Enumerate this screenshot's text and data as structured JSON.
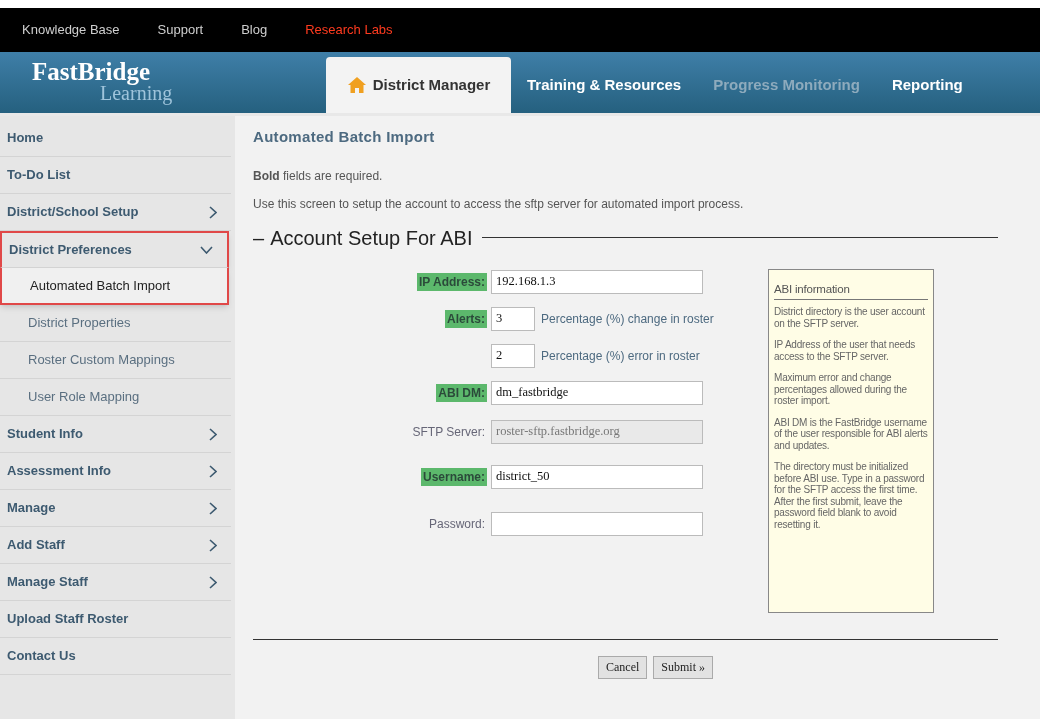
{
  "top_links": [
    {
      "label": "Knowledge Base",
      "highlighted": false
    },
    {
      "label": "Support",
      "highlighted": false
    },
    {
      "label": "Blog",
      "highlighted": false
    },
    {
      "label": "Research Labs",
      "highlighted": true
    }
  ],
  "logo": {
    "name": "FastBridge",
    "subtitle": "Learning"
  },
  "tabs": [
    {
      "label": "District Manager",
      "selected": true,
      "disabled": false
    },
    {
      "label": "Training & Resources",
      "selected": false,
      "disabled": false
    },
    {
      "label": "Progress Monitoring",
      "selected": false,
      "disabled": true
    },
    {
      "label": "Reporting",
      "selected": false,
      "disabled": false
    }
  ],
  "sidebar": {
    "items": [
      {
        "label": "Home",
        "highlighted": false
      },
      {
        "label": "To-Do List",
        "highlighted": false
      },
      {
        "label": "District/School Setup",
        "expanded": false,
        "highlighted": false
      },
      {
        "label": "District Preferences",
        "expanded": true,
        "highlighted": true,
        "children": [
          {
            "label": "Automated Batch Import",
            "selected": true,
            "highlighted": true
          },
          {
            "label": "District Properties",
            "selected": false,
            "highlighted": false
          },
          {
            "label": "Roster Custom Mappings",
            "selected": false,
            "highlighted": false
          },
          {
            "label": "User Role Mapping",
            "selected": false,
            "highlighted": false
          }
        ]
      },
      {
        "label": "Student Info",
        "expanded": false,
        "highlighted": false
      },
      {
        "label": "Assessment Info",
        "expanded": false,
        "highlighted": false
      },
      {
        "label": "Manage",
        "expanded": false,
        "highlighted": false
      },
      {
        "label": "Add Staff",
        "expanded": false,
        "highlighted": false
      },
      {
        "label": "Manage Staff",
        "expanded": false,
        "highlighted": false
      },
      {
        "label": "Upload Staff Roster",
        "highlighted": false
      },
      {
        "label": "Contact Us",
        "highlighted": false
      }
    ]
  },
  "page_title": "Automated Batch Import",
  "required_note": "**Bold** fields are required.",
  "description": "Use this screen to setup the account to access the sftp server for automated import process.",
  "section_title": "Account Setup For ABI",
  "section_marker": "–",
  "form": [
    {
      "kind": "text",
      "label": "IP Address:",
      "required": true,
      "disabled": false,
      "value": "192.168.1.3"
    },
    {
      "kind": "percent",
      "label": "Alerts:",
      "required": true,
      "disabled": false,
      "value": "3",
      "note": "Percentage (%) change in roster"
    },
    {
      "kind": "percent",
      "disabled": false,
      "value": "2",
      "note": "Percentage (%) error in roster"
    },
    {
      "kind": "text",
      "label": "ABI DM:",
      "required": true,
      "disabled": false,
      "value": "dm_fastbridge"
    },
    {
      "kind": "text",
      "label": "SFTP Server:",
      "required": false,
      "disabled": true,
      "value": "roster-sftp.fastbridge.org"
    },
    {
      "kind": "text",
      "label": "Username:",
      "required": true,
      "disabled": false,
      "value": "district_50"
    },
    {
      "kind": "password",
      "label": "Password:",
      "required": false,
      "disabled": false
    }
  ],
  "info": {
    "title": "ABI information",
    "paragraphs": [
      "District directory is the user account on the SFTP server.",
      "IP Address of the user that needs access to the SFTP server.",
      "Maximum error and change percentages allowed during the roster import.",
      "ABI DM is the FastBridge username of the user responsible for ABI alerts and updates.",
      "The directory must be initialized before ABI use. Type in a password for the SFTP access the first time. After the first submit, leave the password field blank to avoid resetting it."
    ]
  },
  "buttons": [
    "Cancel",
    "Submit »"
  ]
}
